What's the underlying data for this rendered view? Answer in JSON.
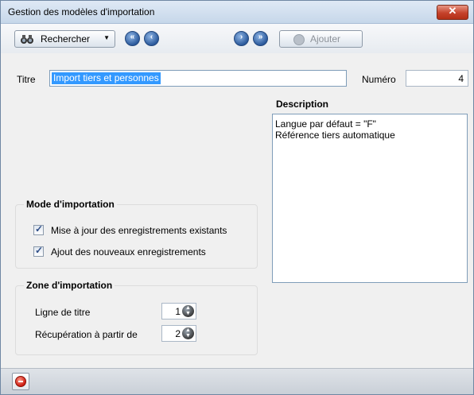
{
  "window": {
    "title": "Gestion des modèles d'importation",
    "close_glyph": "✕"
  },
  "toolbar": {
    "search_label": "Rechercher",
    "search_icon": "binoculars-icon",
    "dropdown_glyph": "▼",
    "nav_first_glyph": "«",
    "nav_prev_glyph": "‹",
    "nav_next_glyph": "›",
    "nav_last_glyph": "»",
    "add_label": "Ajouter"
  },
  "form": {
    "titre_label": "Titre",
    "titre_value": "Import tiers et personnes",
    "numero_label": "Numéro",
    "numero_value": "4",
    "description_label": "Description",
    "description_lines": [
      "Langue par défaut = \"F\"",
      "Référence tiers automatique"
    ]
  },
  "mode": {
    "title": "Mode d'importation",
    "options": [
      {
        "label": "Mise à jour des enregistrements existants",
        "checked": true
      },
      {
        "label": "Ajout des nouveaux enregistrements",
        "checked": true
      }
    ]
  },
  "zone": {
    "title": "Zone d'importation",
    "ligne_titre_label": "Ligne de titre",
    "ligne_titre_value": "1",
    "recuperation_label": "Récupération à partir de",
    "recuperation_value": "2"
  },
  "colors": {
    "selection": "#3399ff",
    "close_button": "#c5422b"
  }
}
